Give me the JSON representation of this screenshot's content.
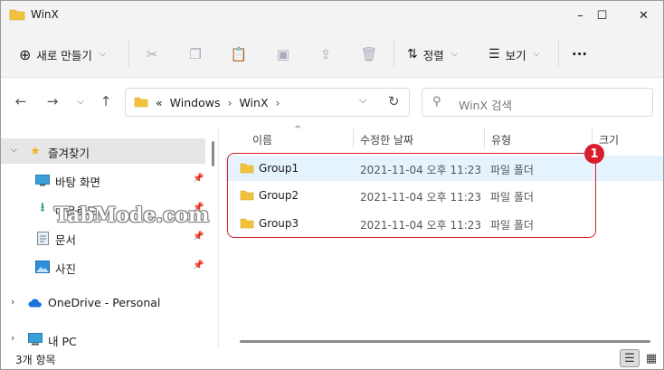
{
  "window": {
    "title": "WinX"
  },
  "titlebar": {
    "minimize": "–",
    "maximize": "☐",
    "close": "✕"
  },
  "commandbar": {
    "new_label": "새로 만들기",
    "sort_label": "정렬",
    "view_label": "보기",
    "more_label": "···"
  },
  "address": {
    "overflow": "«",
    "crumbs": [
      "Windows",
      "WinX"
    ],
    "search_placeholder": "WinX 검색"
  },
  "sidebar": {
    "items": [
      {
        "label": "즐겨찾기",
        "icon": "star-icon"
      },
      {
        "label": "바탕 화면",
        "icon": "desktop-icon"
      },
      {
        "label": "다운로드",
        "icon": "download-icon"
      },
      {
        "label": "문서",
        "icon": "document-icon"
      },
      {
        "label": "사진",
        "icon": "pictures-icon"
      },
      {
        "label": "OneDrive - Personal",
        "icon": "cloud-icon"
      },
      {
        "label": "내 PC",
        "icon": "pc-icon"
      }
    ]
  },
  "filelist": {
    "columns": [
      "이름",
      "수정한 날짜",
      "유형",
      "크기"
    ],
    "rows": [
      {
        "name": "Group1",
        "date": "2021-11-04 오후 11:23",
        "type": "파일 폴더"
      },
      {
        "name": "Group2",
        "date": "2021-11-04 오후 11:23",
        "type": "파일 폴더"
      },
      {
        "name": "Group3",
        "date": "2021-11-04 오후 11:23",
        "type": "파일 폴더"
      }
    ]
  },
  "annotation": {
    "badge": "1"
  },
  "watermark": "TabMode.com",
  "status": {
    "count": "3개 항목"
  },
  "colors": {
    "accent": "#d81e2c",
    "folder": "#f3c23d",
    "selected_row": "#e5f3ff"
  }
}
